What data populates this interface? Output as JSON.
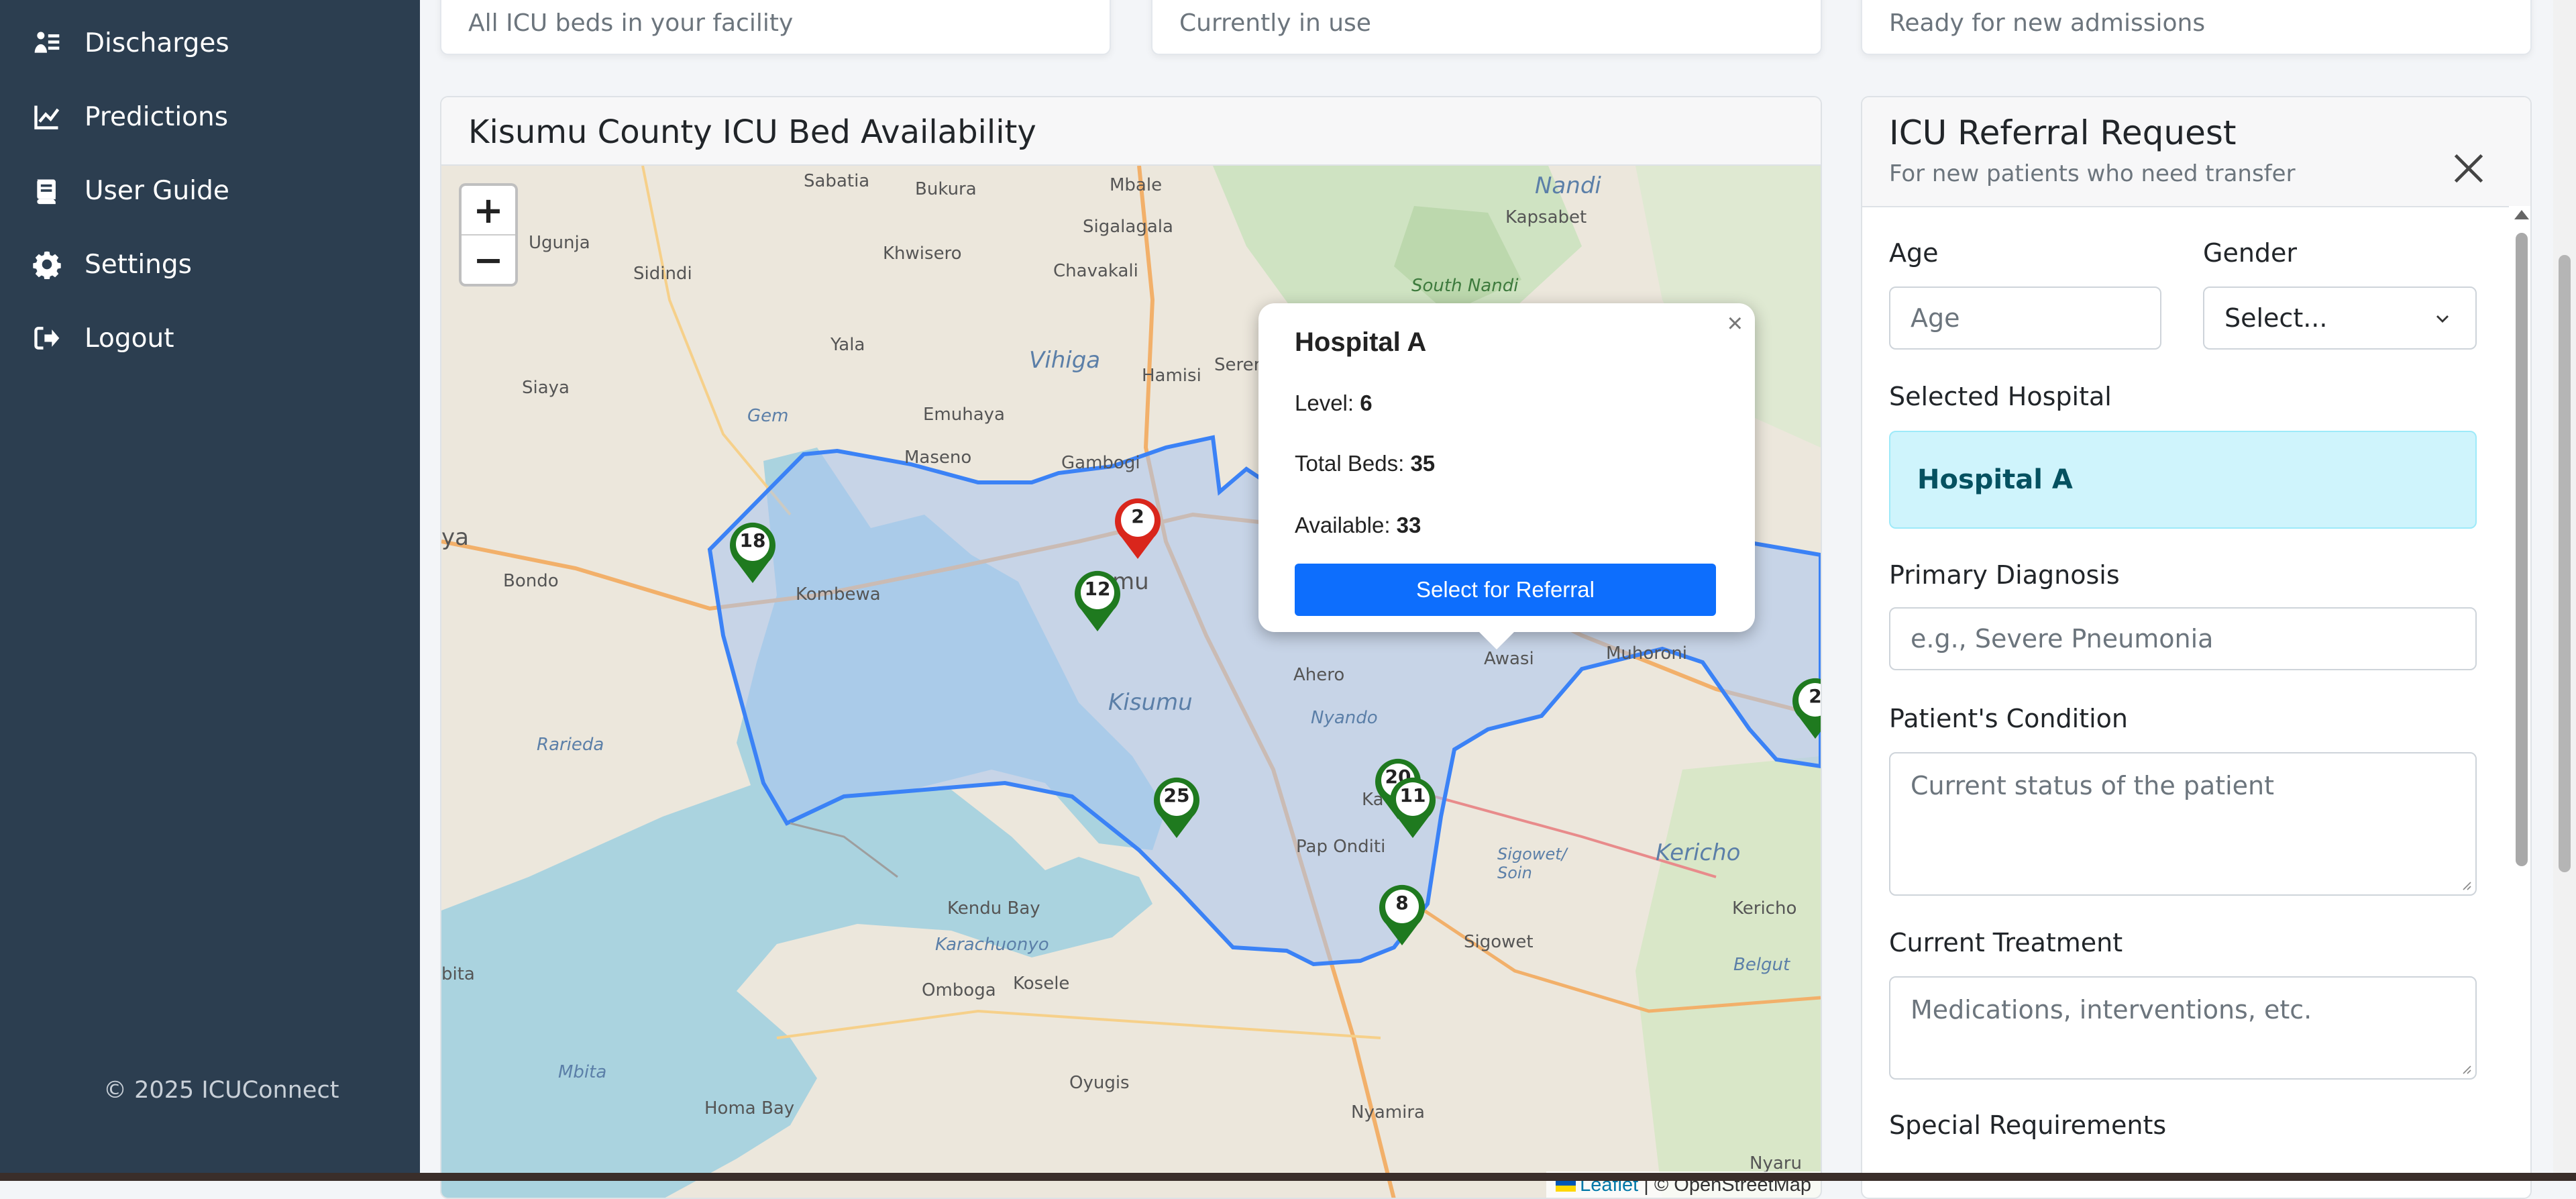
{
  "sidebar": {
    "items": [
      {
        "label": "Discharges",
        "icon": "discharges-icon"
      },
      {
        "label": "Predictions",
        "icon": "chart-line-icon"
      },
      {
        "label": "User Guide",
        "icon": "book-icon"
      },
      {
        "label": "Settings",
        "icon": "gear-icon"
      },
      {
        "label": "Logout",
        "icon": "logout-icon"
      }
    ],
    "copyright": "© 2025 ICUConnect"
  },
  "stats": [
    {
      "subtitle": "All ICU beds in your facility"
    },
    {
      "subtitle": "Currently in use"
    },
    {
      "subtitle": "Ready for new admissions"
    }
  ],
  "map": {
    "title": "Kisumu County ICU Bed Availability",
    "zoom_in": "+",
    "zoom_out": "−",
    "labels": {
      "sabatia": "Sabatia",
      "bukura": "Bukura",
      "mbale": "Mbale",
      "nandi": "Nandi",
      "ugunja": "Ugunja",
      "sigalagala": "Sigalagala",
      "kapsabet": "Kapsabet",
      "sidindi": "Sidindi",
      "khwisero": "Khwisero",
      "chavakali": "Chavakali",
      "south_nandi": "South Nandi",
      "yala": "Yala",
      "vihiga": "Vihiga",
      "hamisi": "Hamisi",
      "serem": "Seren",
      "siaya": "Siaya",
      "emuhaya": "Emuhaya",
      "gem": "Gem",
      "maseno": "Maseno",
      "gambogi": "Gambogi",
      "ya": "ya",
      "bondo": "Bondo",
      "kombewa": "Kombewa",
      "kisumu_city": "mu",
      "ahero": "Ahero",
      "awasi": "Awasi",
      "muhoroni": "Muhoroni",
      "kisumu": "Kisumu",
      "nyando": "Nyando",
      "rarieda": "Rarieda",
      "kano": "Ka",
      "pap_onditi": "Pap Onditi",
      "sigowet_soin": "Sigowet/\nSoin",
      "kericho": "Kericho",
      "kendu_bay": "Kendu Bay",
      "karachuonyo": "Karachuonyo",
      "sigowet": "Sigowet",
      "kericho_town": "Kericho",
      "belgut": "Belgut",
      "bita": "bita",
      "omboga": "Omboga",
      "kosele": "Kosele",
      "mbita": "Mbita",
      "oyugis": "Oyugis",
      "homa_bay": "Homa Bay",
      "nyamira": "Nyamira",
      "nyaru": "Nyaru"
    },
    "markers": [
      {
        "count": "18",
        "status": "available"
      },
      {
        "count": "2",
        "status": "selected"
      },
      {
        "count": "12",
        "status": "available"
      },
      {
        "count": "25",
        "status": "available"
      },
      {
        "count": "20",
        "status": "available"
      },
      {
        "count": "11",
        "status": "available"
      },
      {
        "count": "8",
        "status": "available"
      },
      {
        "count": "2",
        "status": "available"
      }
    ],
    "popup": {
      "name": "Hospital A",
      "level_label": "Level: ",
      "level": "6",
      "beds_label": "Total Beds: ",
      "beds": "35",
      "available_label": "Available: ",
      "available": "33",
      "button": "Select for Referral",
      "close": "×"
    },
    "attribution": {
      "leaflet": "Leaflet",
      "osm": " | © OpenStreetMap"
    },
    "colors": {
      "available": "#1f7a1f",
      "selected": "#d9261c",
      "county_fill": "#a9c4f0",
      "county_border": "#3b82f6",
      "lake": "#a8cfe0"
    }
  },
  "referral": {
    "title": "ICU Referral Request",
    "subtitle": "For new patients who need transfer",
    "age_label": "Age",
    "age_placeholder": "Age",
    "gender_label": "Gender",
    "gender_value": "Select...",
    "selected_hospital_label": "Selected Hospital",
    "selected_hospital": "Hospital A",
    "diagnosis_label": "Primary Diagnosis",
    "diagnosis_placeholder": "e.g., Severe Pneumonia",
    "condition_label": "Patient's Condition",
    "condition_placeholder": "Current status of the patient",
    "treatment_label": "Current Treatment",
    "treatment_placeholder": "Medications, interventions, etc.",
    "requirements_label": "Special Requirements"
  }
}
